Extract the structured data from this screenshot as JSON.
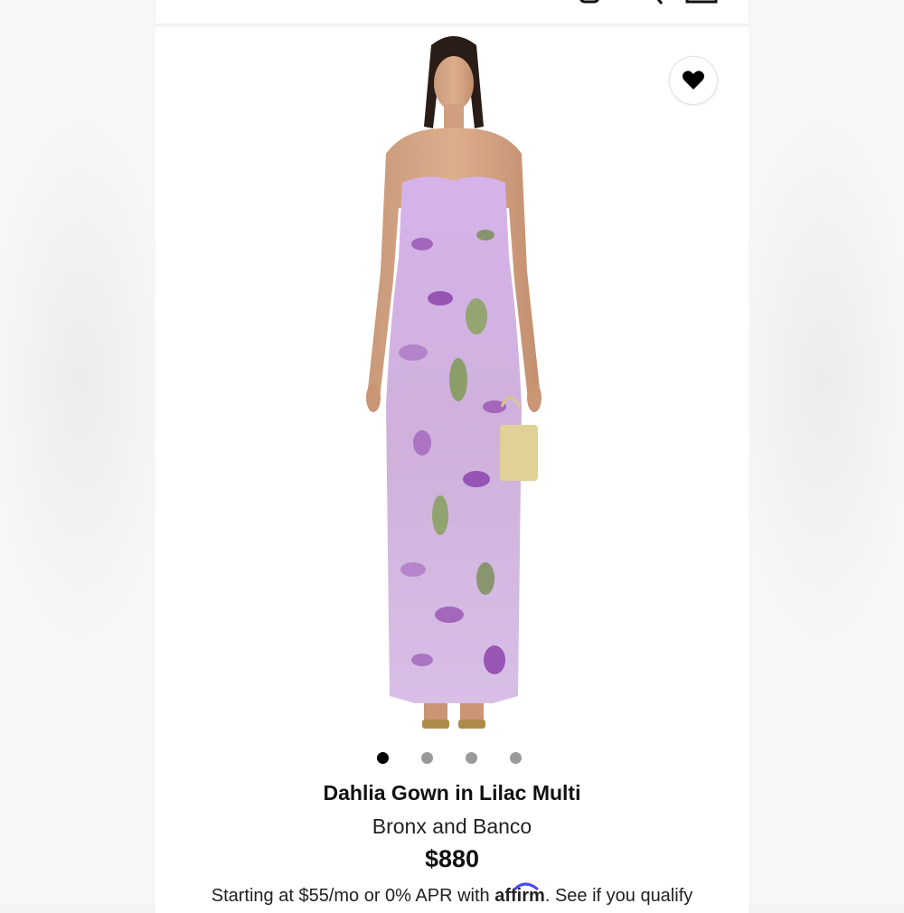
{
  "header": {
    "icons": [
      "account-icon",
      "search-icon",
      "bag-icon"
    ]
  },
  "product": {
    "image_alt": "Model wearing strapless floral embroidered gown",
    "gallery_count": 4,
    "gallery_active_index": 0,
    "name": "Dahlia Gown in Lilac Multi",
    "brand": "Bronx and Banco",
    "price": "$880"
  },
  "financing": {
    "prefix": "Starting at $55/mo or 0% APR with",
    "provider": "affirm",
    "separator": ".",
    "link": "See if you qualify"
  },
  "colors": {
    "accent": "#000000",
    "dot_inactive": "#9a9a9a",
    "affirm_blue": "#4a4af4",
    "dress_lilac": "#c8a2e0"
  }
}
